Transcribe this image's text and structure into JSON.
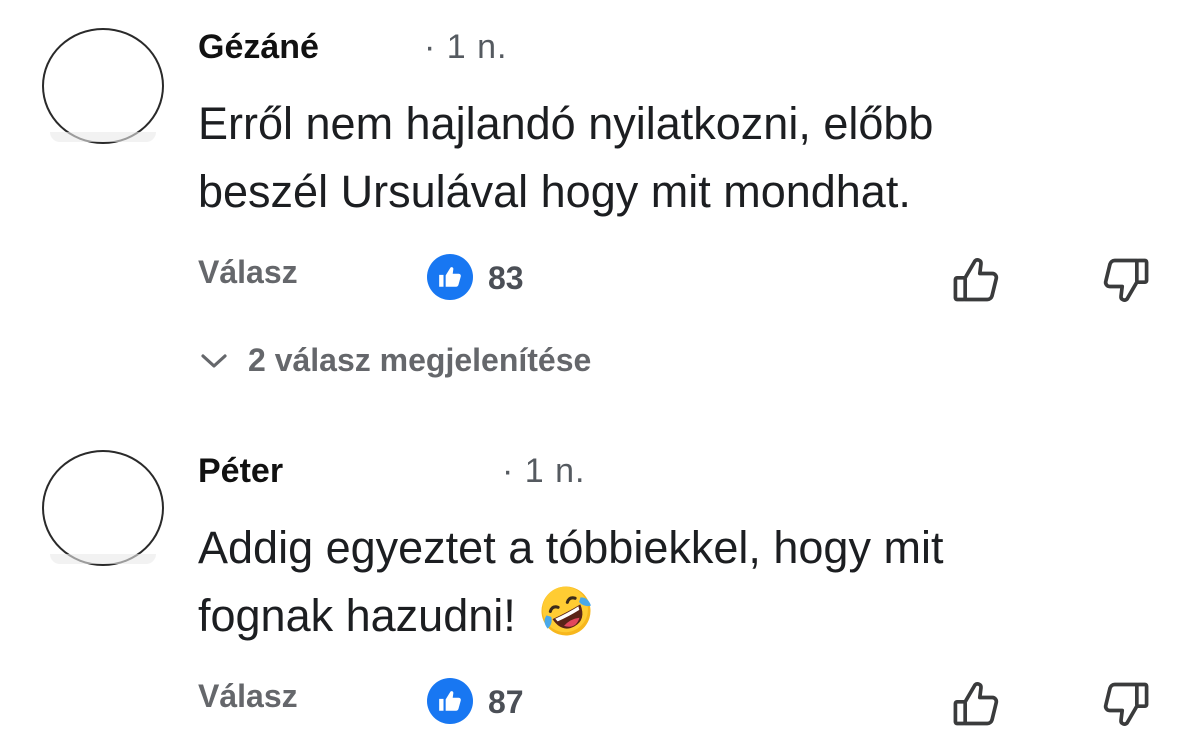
{
  "comments": [
    {
      "author": "Gézáné",
      "time": "· 1 n.",
      "text_line1": "Erről nem hajlandó nyilatkozni, előbb",
      "text_line2": "beszél  Ursulával hogy mit mondhat.",
      "reply_label": "Válasz",
      "like_count": "83",
      "replies_label": "2 válasz megjelenítése"
    },
    {
      "author": "Péter",
      "time": "· 1 n.",
      "text_line1": "Addig egyeztet a tóbbiekkel, hogy mit",
      "text_line2": "fognak hazudni!",
      "emoji": "rolling-on-floor-laughing-emoji",
      "reply_label": "Válasz",
      "like_count": "87"
    }
  ],
  "colors": {
    "like_blue": "#1877f2",
    "secondary_text": "#65676b",
    "primary_text": "#1c1e21"
  },
  "icons": {
    "like_badge": "thumbs-up-icon",
    "upvote": "thumb-up-outline-icon",
    "downvote": "thumb-down-outline-icon",
    "expand": "chevron-down-icon"
  }
}
